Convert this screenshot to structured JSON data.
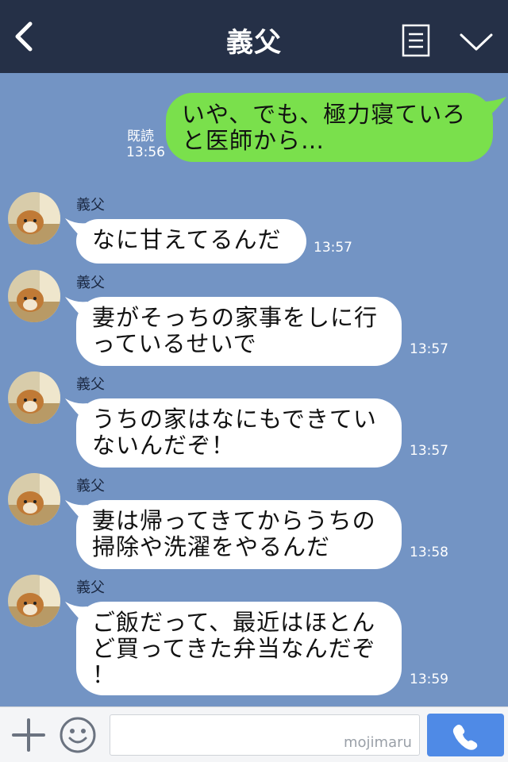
{
  "header": {
    "title": "義父",
    "back_icon": "chevron-left-icon",
    "menu_icon": "menu-list-icon",
    "collapse_icon": "chevron-down-icon"
  },
  "colors": {
    "header_bg": "#253047",
    "chat_bg": "#7394c4",
    "outgoing_bubble": "#7ae04c",
    "incoming_bubble": "#ffffff",
    "call_button": "#4f8ae6"
  },
  "messages": [
    {
      "direction": "outgoing",
      "lines": [
        "いや、でも、極力寝ていろ",
        "と医師から…"
      ],
      "read_label": "既読",
      "time": "13:56"
    },
    {
      "direction": "incoming",
      "sender": "義父",
      "lines": [
        "なに甘えてるんだ"
      ],
      "time": "13:57"
    },
    {
      "direction": "incoming",
      "sender": "義父",
      "lines": [
        "妻がそっちの家事をしに行",
        "っているせいで"
      ],
      "time": "13:57"
    },
    {
      "direction": "incoming",
      "sender": "義父",
      "lines": [
        "うちの家はなにもできてい",
        "ないんだぞ！"
      ],
      "time": "13:57"
    },
    {
      "direction": "incoming",
      "sender": "義父",
      "lines": [
        "妻は帰ってきてからうちの",
        "掃除や洗濯をやるんだ"
      ],
      "time": "13:58"
    },
    {
      "direction": "incoming",
      "sender": "義父",
      "lines": [
        "ご飯だって、最近はほとん",
        "ど買ってきた弁当なんだぞ",
        "！"
      ],
      "time": "13:59"
    }
  ],
  "input_bar": {
    "plus_icon": "plus-icon",
    "emoji_icon": "smiley-icon",
    "input_value": "",
    "watermark": "mojimaru",
    "call_icon": "phone-icon"
  }
}
